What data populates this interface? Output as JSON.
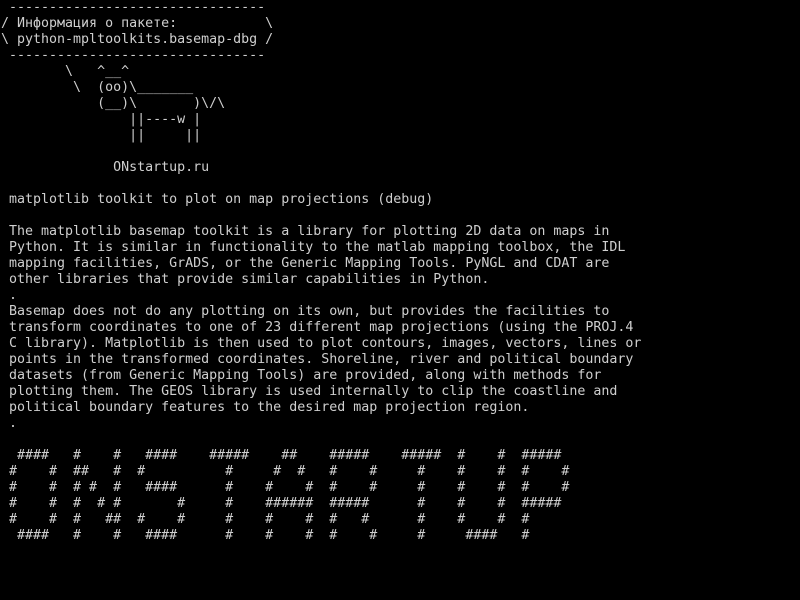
{
  "screen": {
    "background": "#000000",
    "foreground": "#cfcfcf"
  },
  "cowsay": {
    "art": " --------------------------------\n/ Информация о пакете:           \\\n\\ python-mpltoolkits.basemap-dbg /\n --------------------------------\n        \\   ^__^\n         \\  (oo)\\_______\n            (__)\\       )\\/\\\n                ||----w |\n                ||     ||\n\n              ONstartup.ru"
  },
  "package": {
    "summary": " matplotlib toolkit to plot on map projections (debug)",
    "description_p1": " The matplotlib basemap toolkit is a library for plotting 2D data on maps in\n Python. It is similar in functionality to the matlab mapping toolbox, the IDL\n mapping facilities, GrADS, or the Generic Mapping Tools. PyNGL and CDAT are\n other libraries that provide similar capabilities in Python.",
    "separator_1": " .",
    "description_p2": " Basemap does not do any plotting on its own, but provides the facilities to\n transform coordinates to one of 23 different map projections (using the PROJ.4\n C library). Matplotlib is then used to plot contours, images, vectors, lines or\n points in the transformed coordinates. Shoreline, river and political boundary\n datasets (from Generic Mapping Tools) are provided, along with methods for\n plotting them. The GEOS library is used internally to clip the coastline and\n political boundary features to the desired map projection region.",
    "separator_2": " ."
  },
  "banner": {
    "text": "  ####   #    #   ####    #####    ##    #####    #####  #    #  #####\n #    #  ##   #  #          #     #  #   #    #     #    #    #  #    #\n #    #  # #  #   ####      #    #    #  #    #     #    #    #  #    #\n #    #  #  # #       #     #    ######  #####      #    #    #  #####\n #    #  #   ##  #    #     #    #    #  #   #      #    #    #  #\n  ####   #    #   ####      #    #    #  #    #     #     ####   #"
  }
}
